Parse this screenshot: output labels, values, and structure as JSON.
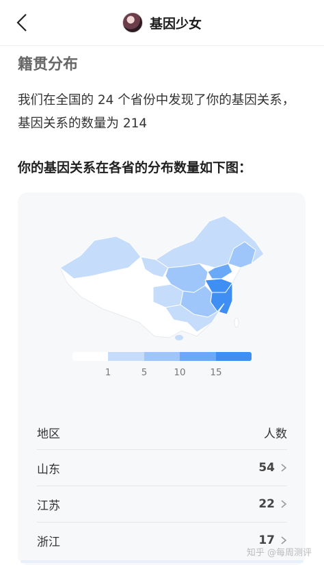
{
  "header": {
    "title": "基因少女"
  },
  "section": {
    "heading": "籍贯分布",
    "summary": "我们在全国的 24 个省份中发现了你的基因关系，基因关系的数量为 214",
    "subheading": "你的基因关系在各省的分布数量如下图："
  },
  "legend": {
    "ticks": [
      "1",
      "5",
      "10",
      "15"
    ],
    "colors": [
      "#ffffff",
      "#c6dcfb",
      "#9ec6fa",
      "#6aa9f7",
      "#3e8ef3"
    ]
  },
  "table": {
    "col_region": "地区",
    "col_count": "人数",
    "rows": [
      {
        "region": "山东",
        "count": "54"
      },
      {
        "region": "江苏",
        "count": "22"
      },
      {
        "region": "浙江",
        "count": "17"
      }
    ]
  },
  "watermark": "知乎 @每周测评",
  "colors": {
    "accent": "#3e8ef3",
    "heading_gray": "#666666"
  },
  "icons": {
    "back": "chevron-left-icon",
    "row_arrow": "chevron-right-icon"
  }
}
